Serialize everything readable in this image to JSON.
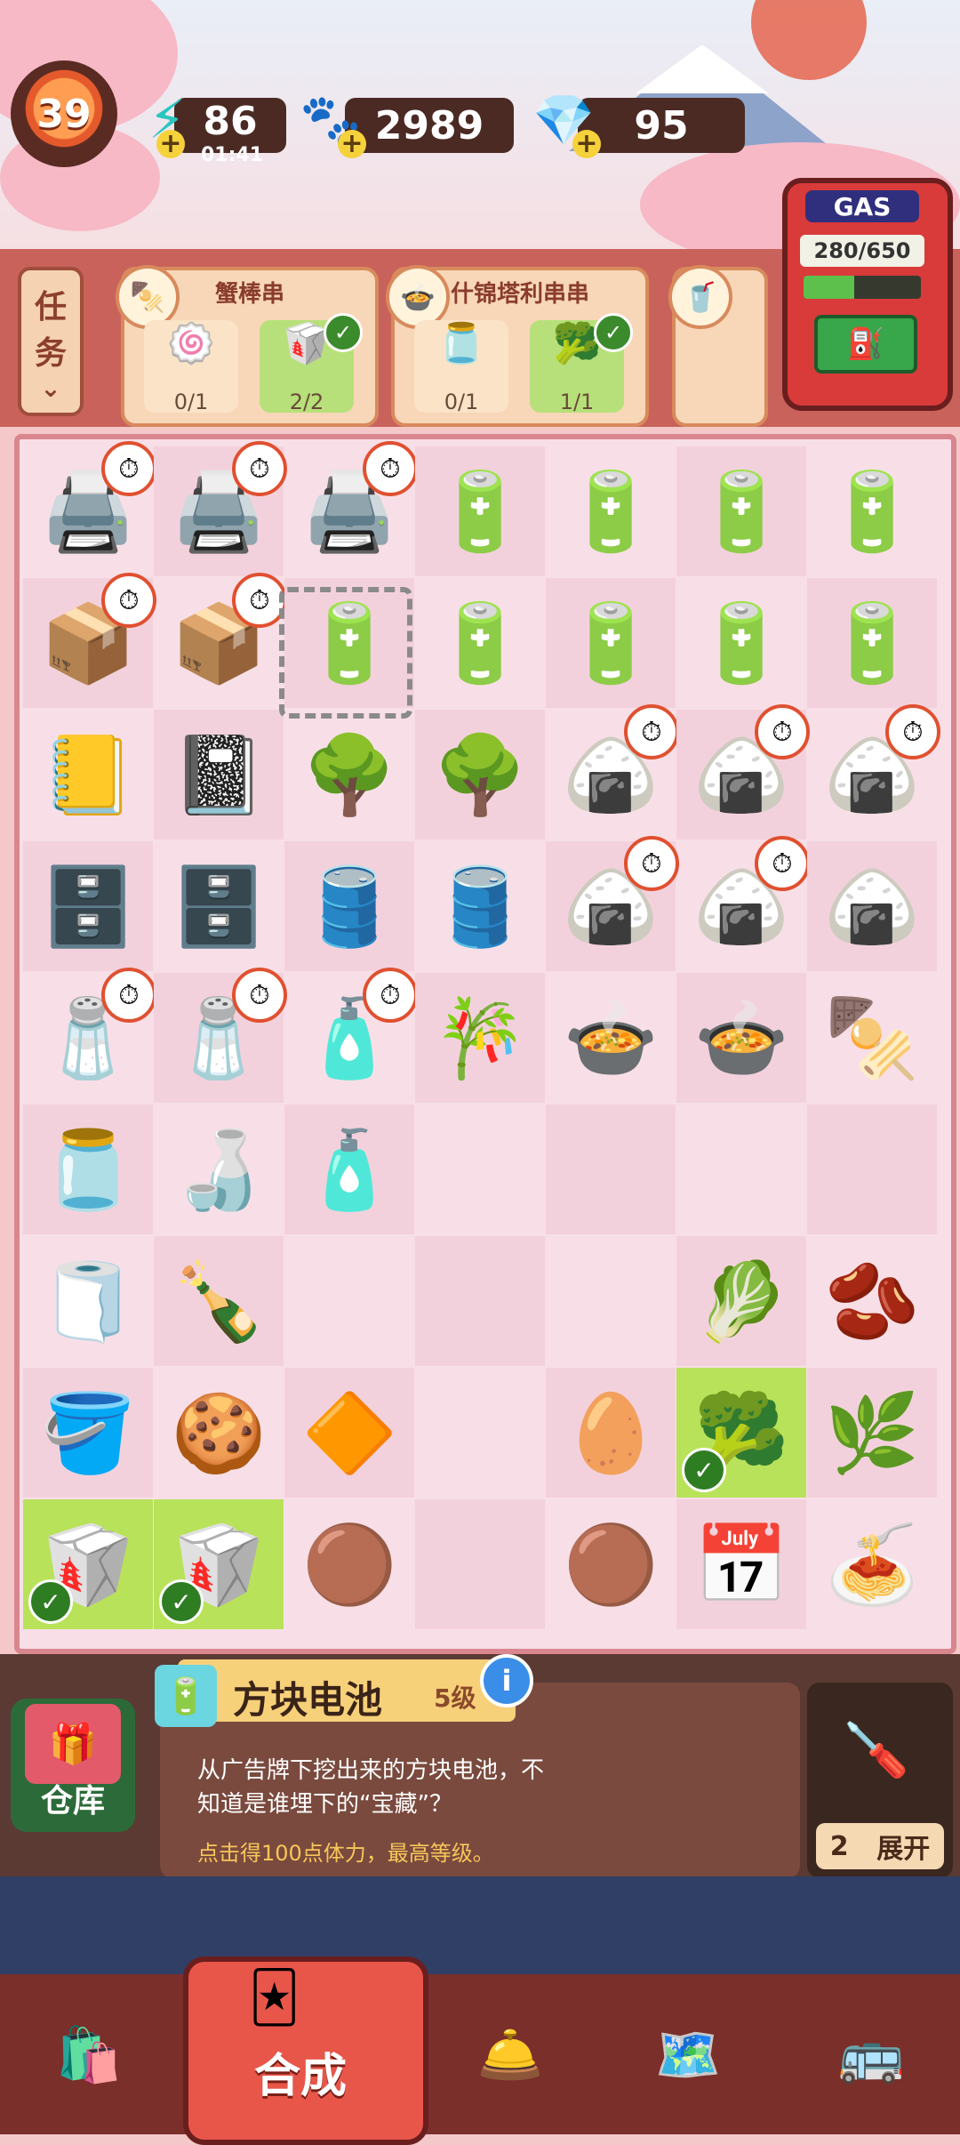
{
  "hud": {
    "level": "39",
    "energy": "86",
    "energy_timer": "01:41",
    "coins": "2989",
    "gems": "95"
  },
  "tasks_button": {
    "line1": "任",
    "line2": "务",
    "arrow": "⌄"
  },
  "orders": [
    {
      "title": "蟹棒串",
      "icon": "🍢",
      "reqs": [
        {
          "icon": "🍥",
          "count": "0/1",
          "done": false
        },
        {
          "icon": "🥡",
          "count": "2/2",
          "done": true
        }
      ]
    },
    {
      "title": "什锦塔利串串",
      "icon": "🍲",
      "reqs": [
        {
          "icon": "🫙",
          "count": "0/1",
          "done": false
        },
        {
          "icon": "🥦",
          "count": "1/1",
          "done": true
        }
      ]
    }
  ],
  "gas": {
    "label": "GAS",
    "value": "280/650",
    "fill": 0.43
  },
  "board": {
    "rows": [
      [
        "🖨️",
        "🖨️",
        "🖨️",
        "🔋",
        "🔋",
        "🔋",
        "🔋"
      ],
      [
        "📦",
        "📦",
        "🔋",
        "🔋",
        "🔋",
        "🔋",
        "🔋"
      ],
      [
        "📒",
        "📓",
        "🌳",
        "🌳",
        "🍙",
        "🍙",
        "🍙"
      ],
      [
        "🗄️",
        "🗄️",
        "🛢️",
        "🛢️",
        "🍙",
        "🍙",
        "🍙"
      ],
      [
        "🧂",
        "🧂",
        "🧴",
        "🎋",
        "🍲",
        "🍲",
        "🍢"
      ],
      [
        "🫙",
        "🍶",
        "🧴",
        "",
        "",
        "",
        ""
      ],
      [
        "🧻",
        "🍾",
        "",
        "",
        "",
        "🥬",
        "🫘"
      ],
      [
        "🪣",
        "🍪",
        "🔶",
        "",
        "🥚",
        "🥦",
        "🌿"
      ],
      [
        "🥡",
        "🥡",
        "🟤",
        "",
        "🟤",
        "📅",
        "🍝"
      ]
    ],
    "timers": [
      [
        0,
        0
      ],
      [
        0,
        1
      ],
      [
        0,
        2
      ],
      [
        1,
        0
      ],
      [
        1,
        1
      ],
      [
        2,
        4
      ],
      [
        2,
        5
      ],
      [
        2,
        6
      ],
      [
        3,
        4
      ],
      [
        3,
        5
      ],
      [
        4,
        0
      ],
      [
        4,
        1
      ],
      [
        4,
        2
      ]
    ],
    "highlighted": [
      [
        7,
        5
      ],
      [
        8,
        0
      ],
      [
        8,
        1
      ]
    ]
  },
  "info": {
    "item_name": "方块电池",
    "item_level": "5级",
    "info_icon": "i",
    "description": "从广告牌下挖出来的方块电池，不知道是谁埋下的“宝藏”？",
    "hint": "点击得100点体力，最高等级。",
    "warehouse_label": "仓库",
    "expand_count": "2",
    "expand_label": "展开"
  },
  "nav": {
    "active_label": "合成"
  }
}
